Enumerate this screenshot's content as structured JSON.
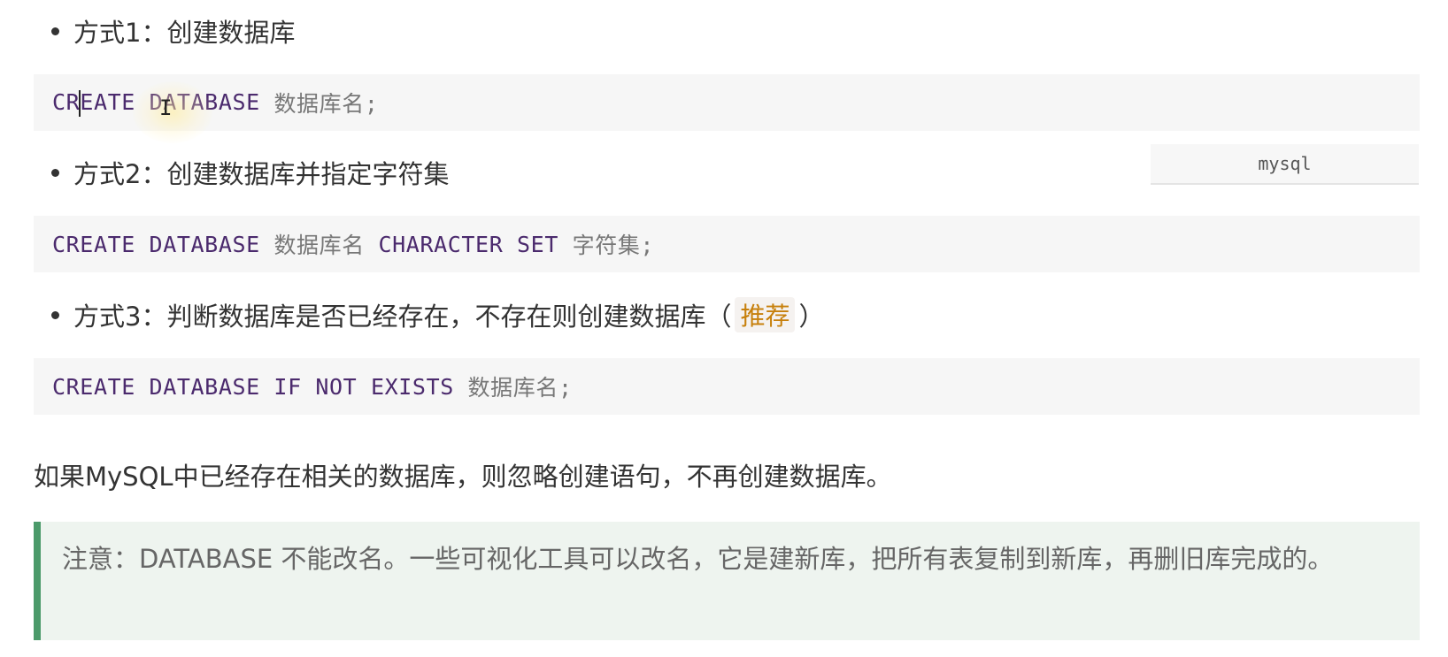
{
  "items": [
    {
      "label": "方式1：创建数据库",
      "code": {
        "kw": "CREATE DATABASE",
        "rest": "数据库名;"
      }
    },
    {
      "label": "方式2：创建数据库并指定字符集",
      "code": {
        "kw1": "CREATE DATABASE",
        "name": "数据库名",
        "kw2": "CHARACTER SET",
        "rest": "字符集;"
      }
    },
    {
      "label_prefix": "方式3：判断数据库是否已经存在，不存在则创建数据库（",
      "label_tag": "推荐",
      "label_suffix": "）",
      "code": {
        "kw": "CREATE DATABASE IF NOT EXISTS",
        "rest": "数据库名;"
      }
    }
  ],
  "code_language": "mysql",
  "paragraph": "如果MySQL中已经存在相关的数据库，则忽略创建语句，不再创建数据库。",
  "note": "注意：DATABASE 不能改名。一些可视化工具可以改名，它是建新库，把所有表复制到新库，再删旧库完成的。",
  "colors": {
    "keyword": "#4b2a6d",
    "plain_code": "#777777",
    "tag": "#c7800c",
    "note_border": "#4b9a6a",
    "note_background": "#eef4ef",
    "code_background": "#f6f6f6"
  }
}
